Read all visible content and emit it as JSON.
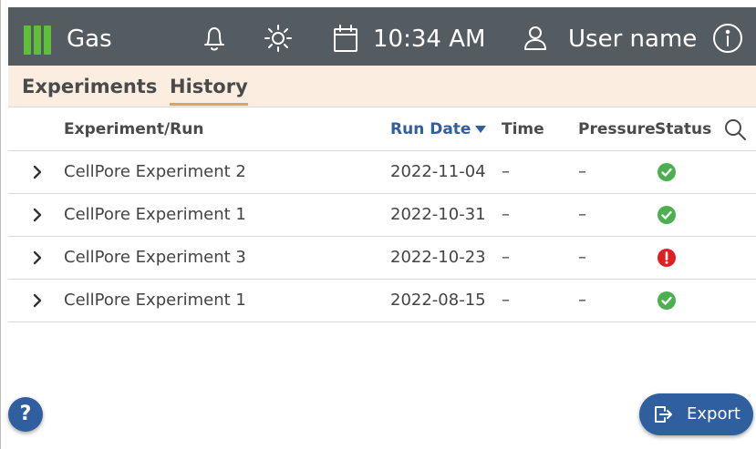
{
  "header": {
    "app_name": "Gas",
    "time": "10:34 AM",
    "user_name": "User name",
    "icons": [
      "bell-icon",
      "sun-icon",
      "calendar-icon",
      "user-icon",
      "info-icon"
    ],
    "gas_indicator_color": "#5fbf3a",
    "bar_color": "#555c61"
  },
  "tabs": [
    {
      "label": "Experiments",
      "active": false
    },
    {
      "label": "History",
      "active": true
    }
  ],
  "table": {
    "columns": {
      "experiment_run": "Experiment/Run",
      "run_date": "Run Date",
      "time": "Time",
      "pressure": "Pressure",
      "status": "Status"
    },
    "sort": {
      "column": "run_date",
      "direction": "descending"
    },
    "rows": [
      {
        "name": "CellPore Experiment 2",
        "date": "2022-11-04",
        "time": "–",
        "pressure": "–",
        "status": "ok"
      },
      {
        "name": "CellPore Experiment 1",
        "date": "2022-10-31",
        "time": "–",
        "pressure": "–",
        "status": "ok"
      },
      {
        "name": "CellPore Experiment 3",
        "date": "2022-10-23",
        "time": "–",
        "pressure": "–",
        "status": "error"
      },
      {
        "name": "CellPore Experiment 1",
        "date": "2022-08-15",
        "time": "–",
        "pressure": "–",
        "status": "ok"
      }
    ]
  },
  "buttons": {
    "help": "?",
    "export": "Export"
  },
  "colors": {
    "accent": "#2f5f9e",
    "tab_bar": "#fbeee0",
    "ok": "#4caf50",
    "error": "#e02020"
  }
}
